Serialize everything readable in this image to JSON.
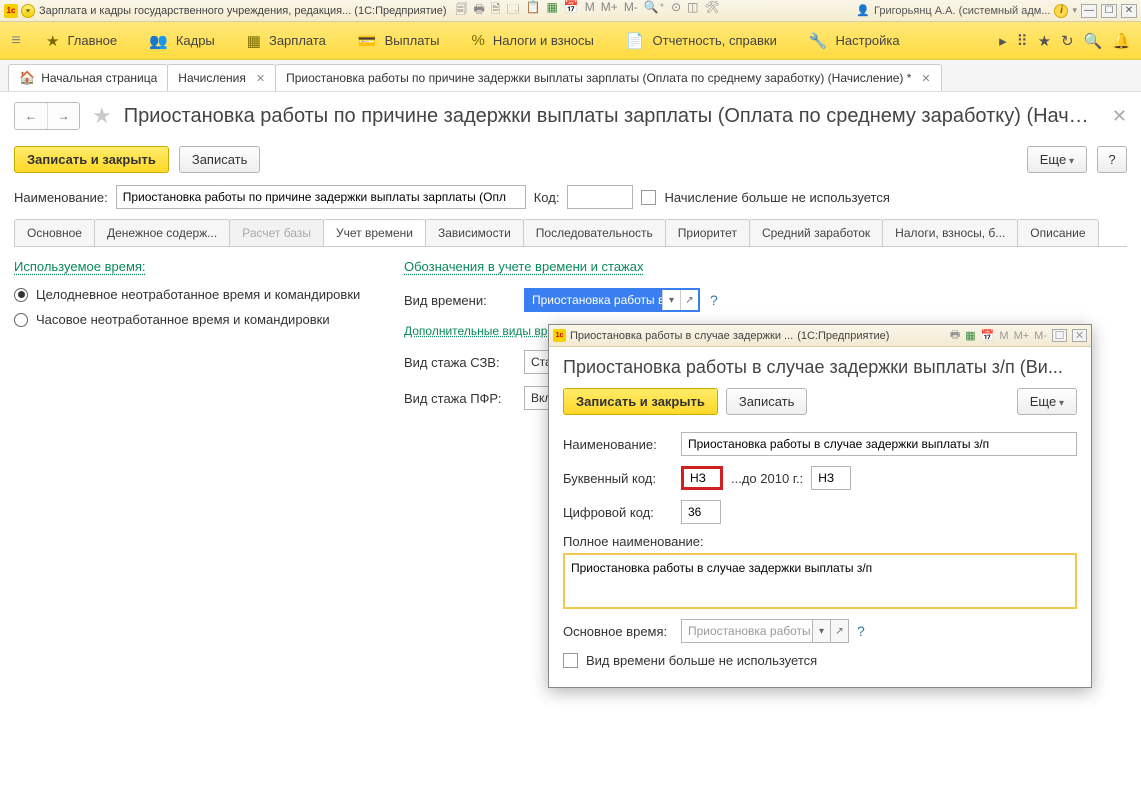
{
  "titlebar": {
    "app": "Зарплата и кадры государственного учреждения, редакция...",
    "platform": "(1С:Предприятие)",
    "user": "Григорьянц А.А. (системный адм...",
    "info_glyph": "i"
  },
  "sections": {
    "main": "Главное",
    "kadry": "Кадры",
    "zarplata": "Зарплата",
    "vyplaty": "Выплаты",
    "nalogi": "Налоги и взносы",
    "otchet": "Отчетность, справки",
    "nastroika": "Настройка"
  },
  "tabs": {
    "home": "Начальная страница",
    "t1": "Начисления",
    "t2": "Приостановка работы по причине задержки выплаты зарплаты (Оплата по среднему заработку) (Начисление) *"
  },
  "page": {
    "title": "Приостановка работы по причине задержки выплаты зарплаты (Оплата по среднему заработку) (Начислени...",
    "write_close": "Записать и закрыть",
    "write": "Записать",
    "more": "Еще",
    "help": "?",
    "name_label": "Наименование:",
    "name_value": "Приостановка работы по причине задержки выплаты зарплаты (Опл",
    "code_label": "Код:",
    "unused_label": "Начисление больше не используется"
  },
  "inner_tabs": {
    "osn": "Основное",
    "den": "Денежное содерж...",
    "rasch": "Расчет базы",
    "uchet": "Учет времени",
    "zav": "Зависимости",
    "posl": "Последовательность",
    "prior": "Приоритет",
    "sred": "Средний заработок",
    "nalogi": "Налоги, взносы, б...",
    "opis": "Описание"
  },
  "left": {
    "head": "Используемое время:",
    "r1": "Целодневное неотработанное время и командировки",
    "r2": "Часовое неотработанное время и командировки"
  },
  "right": {
    "head": "Обозначения в учете времени и стажах",
    "vid_label": "Вид времени:",
    "vid_value": "Приостановка работы в сл",
    "dop": "Дополнительные виды вр",
    "szv_label": "Вид стажа СЗВ:",
    "szv_value": "Стаж д",
    "pfr_label": "Вид стажа ПФР:",
    "pfr_value": "Включа"
  },
  "dialog": {
    "title_text": "Приостановка работы в случае задержки ...",
    "title_platform": "(1С:Предприятие)",
    "heading": "Приостановка работы в случае задержки выплаты з/п (Ви...",
    "write_close": "Записать и закрыть",
    "write": "Записать",
    "more": "Еще",
    "name_label": "Наименование:",
    "name_value": "Приостановка работы в случае задержки выплаты з/п",
    "code_label": "Буквенный код:",
    "code_value": "НЗ",
    "until_label": "...до 2010 г.:",
    "until_value": "НЗ",
    "num_label": "Цифровой код:",
    "num_value": "36",
    "full_label": "Полное наименование:",
    "full_value": "Приостановка работы в случае задержки выплаты з/п",
    "base_label": "Основное время:",
    "base_value": "Приостановка работы в сл",
    "unused_label": "Вид времени больше не используется"
  }
}
